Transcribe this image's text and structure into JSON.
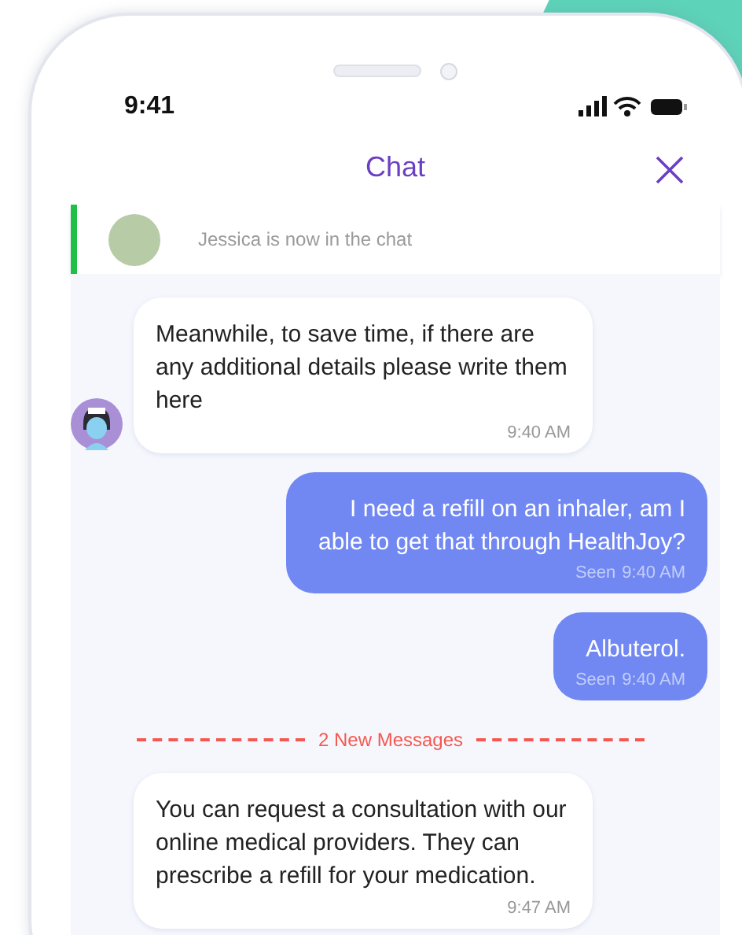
{
  "status_bar": {
    "time": "9:41"
  },
  "header": {
    "title": "Chat"
  },
  "banner": {
    "text": "Jessica is now in the chat"
  },
  "messages": [
    {
      "kind": "received",
      "text": "Meanwhile, to save time, if there are any additional details please write them here",
      "time": "9:40 AM",
      "avatar": true
    },
    {
      "kind": "sent",
      "text": "I need a refill on an inhaler, am I able to get that through HealthJoy?",
      "status": "Seen",
      "time": "9:40 AM"
    },
    {
      "kind": "sent",
      "text": "Albuterol.",
      "status": "Seen",
      "time": "9:40 AM"
    },
    {
      "kind": "divider",
      "text": "2 New Messages"
    },
    {
      "kind": "received",
      "text": "You can request a consultation with our online medical providers. They can prescribe a refill for your medication.",
      "time": "9:47 AM",
      "avatar": false
    }
  ]
}
